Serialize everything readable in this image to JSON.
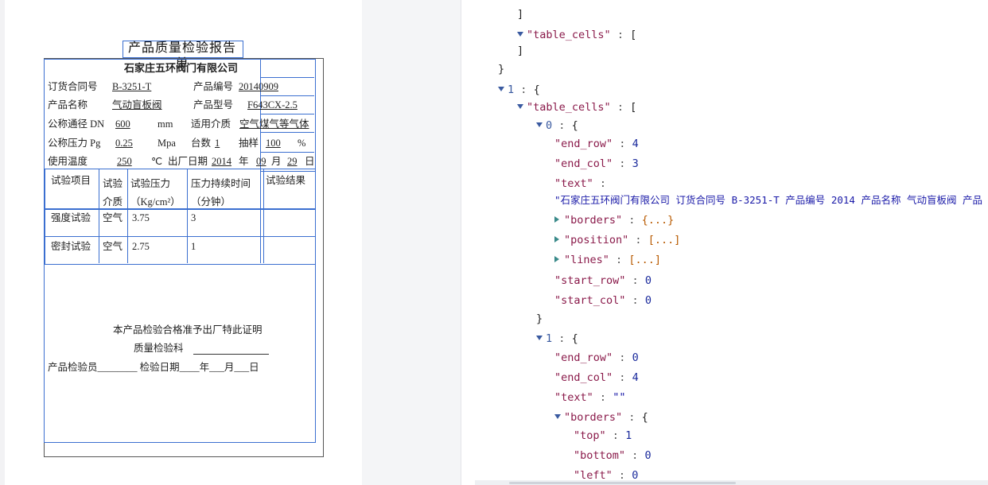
{
  "document": {
    "title": "产品质量检验报告单",
    "company": "石家庄五环阀门有限公司",
    "order_label": "订货合同号",
    "order_value": "B-3251-T",
    "product_no_label": "产品编号",
    "product_no_value": "20140909",
    "product_name_label": "产品名称",
    "product_name_value": "气动盲板阀",
    "product_model_label": "产品型号",
    "product_model_value": "F643CX-2.5",
    "dn_label": "公称通径 DN",
    "dn_value": "600",
    "dn_unit": "mm",
    "medium_label": "适用介质",
    "medium_value": "空气煤气等气体",
    "pressure_label": "公称压力 Pg",
    "pressure_value": "0.25",
    "pressure_unit": "Mpa",
    "count_label": "台数",
    "count_value": "1",
    "sample_label": "抽样",
    "sample_value": "100",
    "sample_unit": "%",
    "temp_label": "使用温度",
    "temp_value": "250",
    "temp_unit": "℃",
    "date_label": "出厂日期",
    "date_year": "2014",
    "year_char": "年",
    "date_month": "09",
    "month_char": "月",
    "date_day": "29",
    "day_char": "日",
    "headers": [
      "试验项目",
      "试验介质",
      "试验压力（Kg/cm²）",
      "压力持续时间（分钟）",
      "试验结果"
    ],
    "rows": [
      {
        "item": "强度试验",
        "medium": "空气",
        "pressure": "3.75",
        "duration": "3",
        "result": ""
      },
      {
        "item": "密封试验",
        "medium": "空气",
        "pressure": "2.75",
        "duration": "1",
        "result": ""
      }
    ],
    "certify": "本产品检验合格准予出厂特此证明",
    "qc_dept": "质量检验科",
    "inspector_line": "产品检验员________ 检验日期____年___月___日"
  },
  "json_view": {
    "bracket_close": "]",
    "table_cells_key": "\"table_cells\"",
    "open_bracket": "[",
    "close_brace": "}",
    "open_brace": "{",
    "colon": ":",
    "idx_1": "1",
    "idx_0": "0",
    "end_row_key": "\"end_row\"",
    "end_col_key": "\"end_col\"",
    "text_key": "\"text\"",
    "borders_key": "\"borders\"",
    "position_key": "\"position\"",
    "lines_key": "\"lines\"",
    "start_row_key": "\"start_row\"",
    "start_col_key": "\"start_col\"",
    "top_key": "\"top\"",
    "bottom_key": "\"bottom\"",
    "left_key": "\"left\"",
    "cell0": {
      "end_row": "4",
      "end_col": "3",
      "text": "\"石家庄五环阀门有限公司 订货合同号 B-3251-T 产品编号 2014 产品名称 气动盲板阀 产品",
      "start_row": "0",
      "start_col": "0"
    },
    "cell1": {
      "end_row": "0",
      "end_col": "4",
      "text": "\"\"",
      "top": "1",
      "bottom": "0",
      "left": "0"
    },
    "collapsed_obj": "{...}",
    "collapsed_arr": "[...]"
  }
}
